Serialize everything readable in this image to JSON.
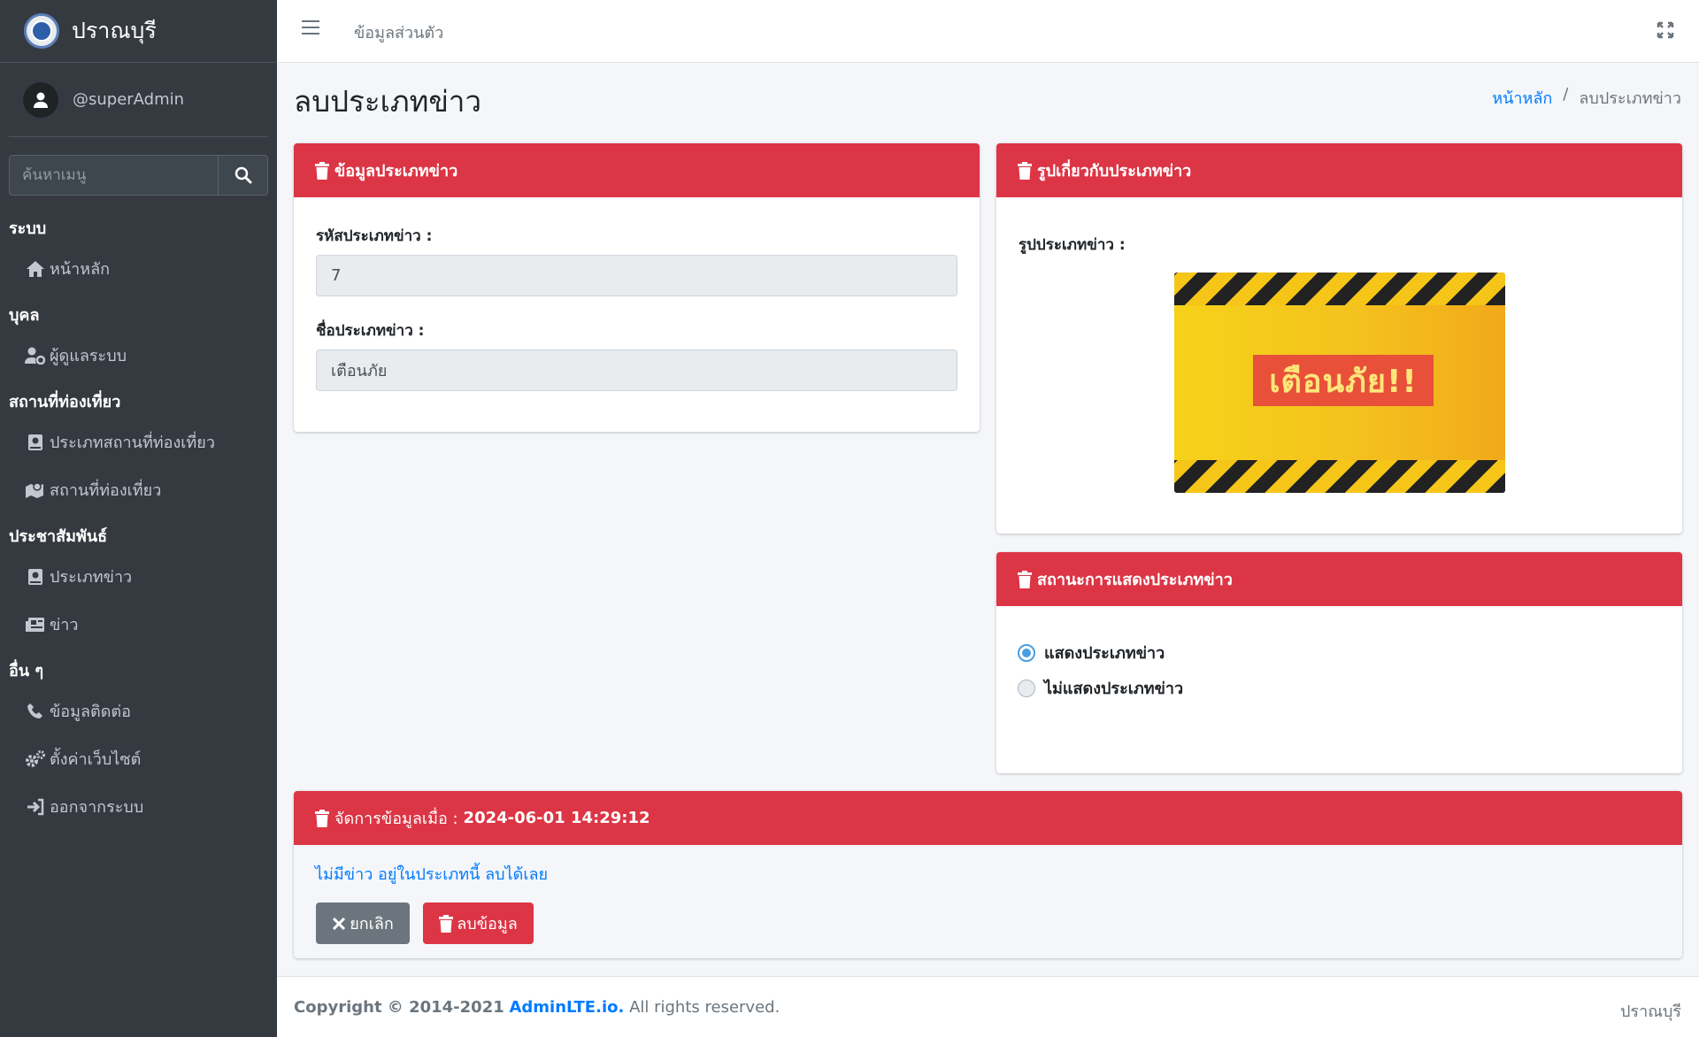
{
  "brand": {
    "name": "ปราณบุรี"
  },
  "user": {
    "name": "@superAdmin"
  },
  "sidebar": {
    "search_placeholder": "ค้นหาเมนู",
    "sections": [
      {
        "header": "ระบบ",
        "items": [
          {
            "label": "หน้าหลัก",
            "icon": "home-icon"
          }
        ]
      },
      {
        "header": "บุคล",
        "items": [
          {
            "label": "ผู้ดูแลระบบ",
            "icon": "user-cog-icon"
          }
        ]
      },
      {
        "header": "สถานที่ท่องเที่ยว",
        "items": [
          {
            "label": "ประเภทสถานที่ท่องเที่ยว",
            "icon": "book-icon"
          },
          {
            "label": "สถานที่ท่องเที่ยว",
            "icon": "map-icon"
          }
        ]
      },
      {
        "header": "ประชาสัมพันธ์",
        "items": [
          {
            "label": "ประเภทข่าว",
            "icon": "book-icon"
          },
          {
            "label": "ข่าว",
            "icon": "newspaper-icon"
          }
        ]
      },
      {
        "header": "อื่น ๆ",
        "items": [
          {
            "label": "ข้อมูลติดต่อ",
            "icon": "phone-icon"
          },
          {
            "label": "ตั้งค่าเว็บไซต์",
            "icon": "cogs-icon"
          },
          {
            "label": "ออกจากระบบ",
            "icon": "sign-out-icon"
          }
        ]
      }
    ]
  },
  "topbar": {
    "link": "ข้อมูลส่วนตัว"
  },
  "page": {
    "title": "ลบประเภทข่าว"
  },
  "breadcrumb": {
    "home": "หน้าหลัก",
    "separator": "/",
    "current": "ลบประเภทข่าว"
  },
  "info_card": {
    "title": "ข้อมูลประเภทข่าว",
    "code_label": "รหัสประเภทข่าว :",
    "code_value": "7",
    "name_label": "ชื่อประเภทข่าว :",
    "name_value": "เตือนภัย"
  },
  "image_card": {
    "title": "รูปเกี่ยวกับประเภทข่าว",
    "image_label": "รูปประเภทข่าว :",
    "image_text": "เตือนภัย!!"
  },
  "status_card": {
    "title": "สถานะการแสดงประเภทข่าว",
    "options": [
      {
        "label": "แสดงประเภทข่าว",
        "checked": true
      },
      {
        "label": "ไม่แสดงประเภทข่าว",
        "checked": false
      }
    ]
  },
  "manage_card": {
    "title_prefix": "จัดการข้อมูลเมื่อ :",
    "timestamp": "2024-06-01 14:29:12",
    "note": "ไม่มีข่าว อยู่ในประเภทนี้ ลบได้เลย",
    "cancel_label": "ยกเลิก",
    "delete_label": "ลบข้อมูล"
  },
  "footer": {
    "copyright_prefix": "Copyright © 2014-2021",
    "link": "AdminLTE.io.",
    "suffix": "All rights reserved.",
    "right": "ปราณบุรี"
  },
  "colors": {
    "danger": "#dc3545",
    "sidebar": "#343a40",
    "link": "#007bff"
  }
}
